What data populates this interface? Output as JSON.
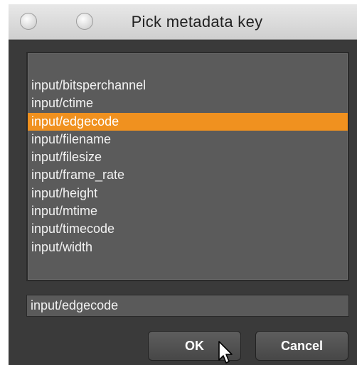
{
  "window": {
    "title": "Pick metadata key"
  },
  "list": {
    "items": [
      "input/bitsperchannel",
      "input/ctime",
      "input/edgecode",
      "input/filename",
      "input/filesize",
      "input/frame_rate",
      "input/height",
      "input/mtime",
      "input/timecode",
      "input/width"
    ],
    "selected_index": 2
  },
  "value_field": {
    "value": "input/edgecode"
  },
  "buttons": {
    "ok_label": "OK",
    "cancel_label": "Cancel"
  },
  "colors": {
    "selection": "#f0911f",
    "background": "#3a3a3a",
    "panel": "#5b5b5b"
  }
}
